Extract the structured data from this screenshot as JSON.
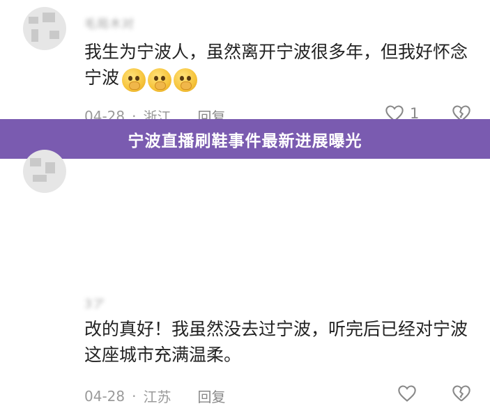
{
  "banner": {
    "title": "宁波直播刷鞋事件最新进展曝光"
  },
  "comments": [
    {
      "username": "毛局木对",
      "text": "我生为宁波人，虽然离开宁波很多年，但我好怀念宁波",
      "emojis": [
        "pleading-face",
        "pleading-face",
        "pleading-face"
      ],
      "date": "04-28",
      "separator": "·",
      "location": "浙江",
      "reply_label": "回复",
      "like_count": "1"
    },
    {
      "username": "3ア",
      "text": "改的真好！我虽然没去过宁波，听完后已经对宁波这座城市充满温柔。",
      "date": "04-28",
      "separator": "·",
      "location": "江苏",
      "reply_label": "回复",
      "like_count": ""
    }
  ]
}
